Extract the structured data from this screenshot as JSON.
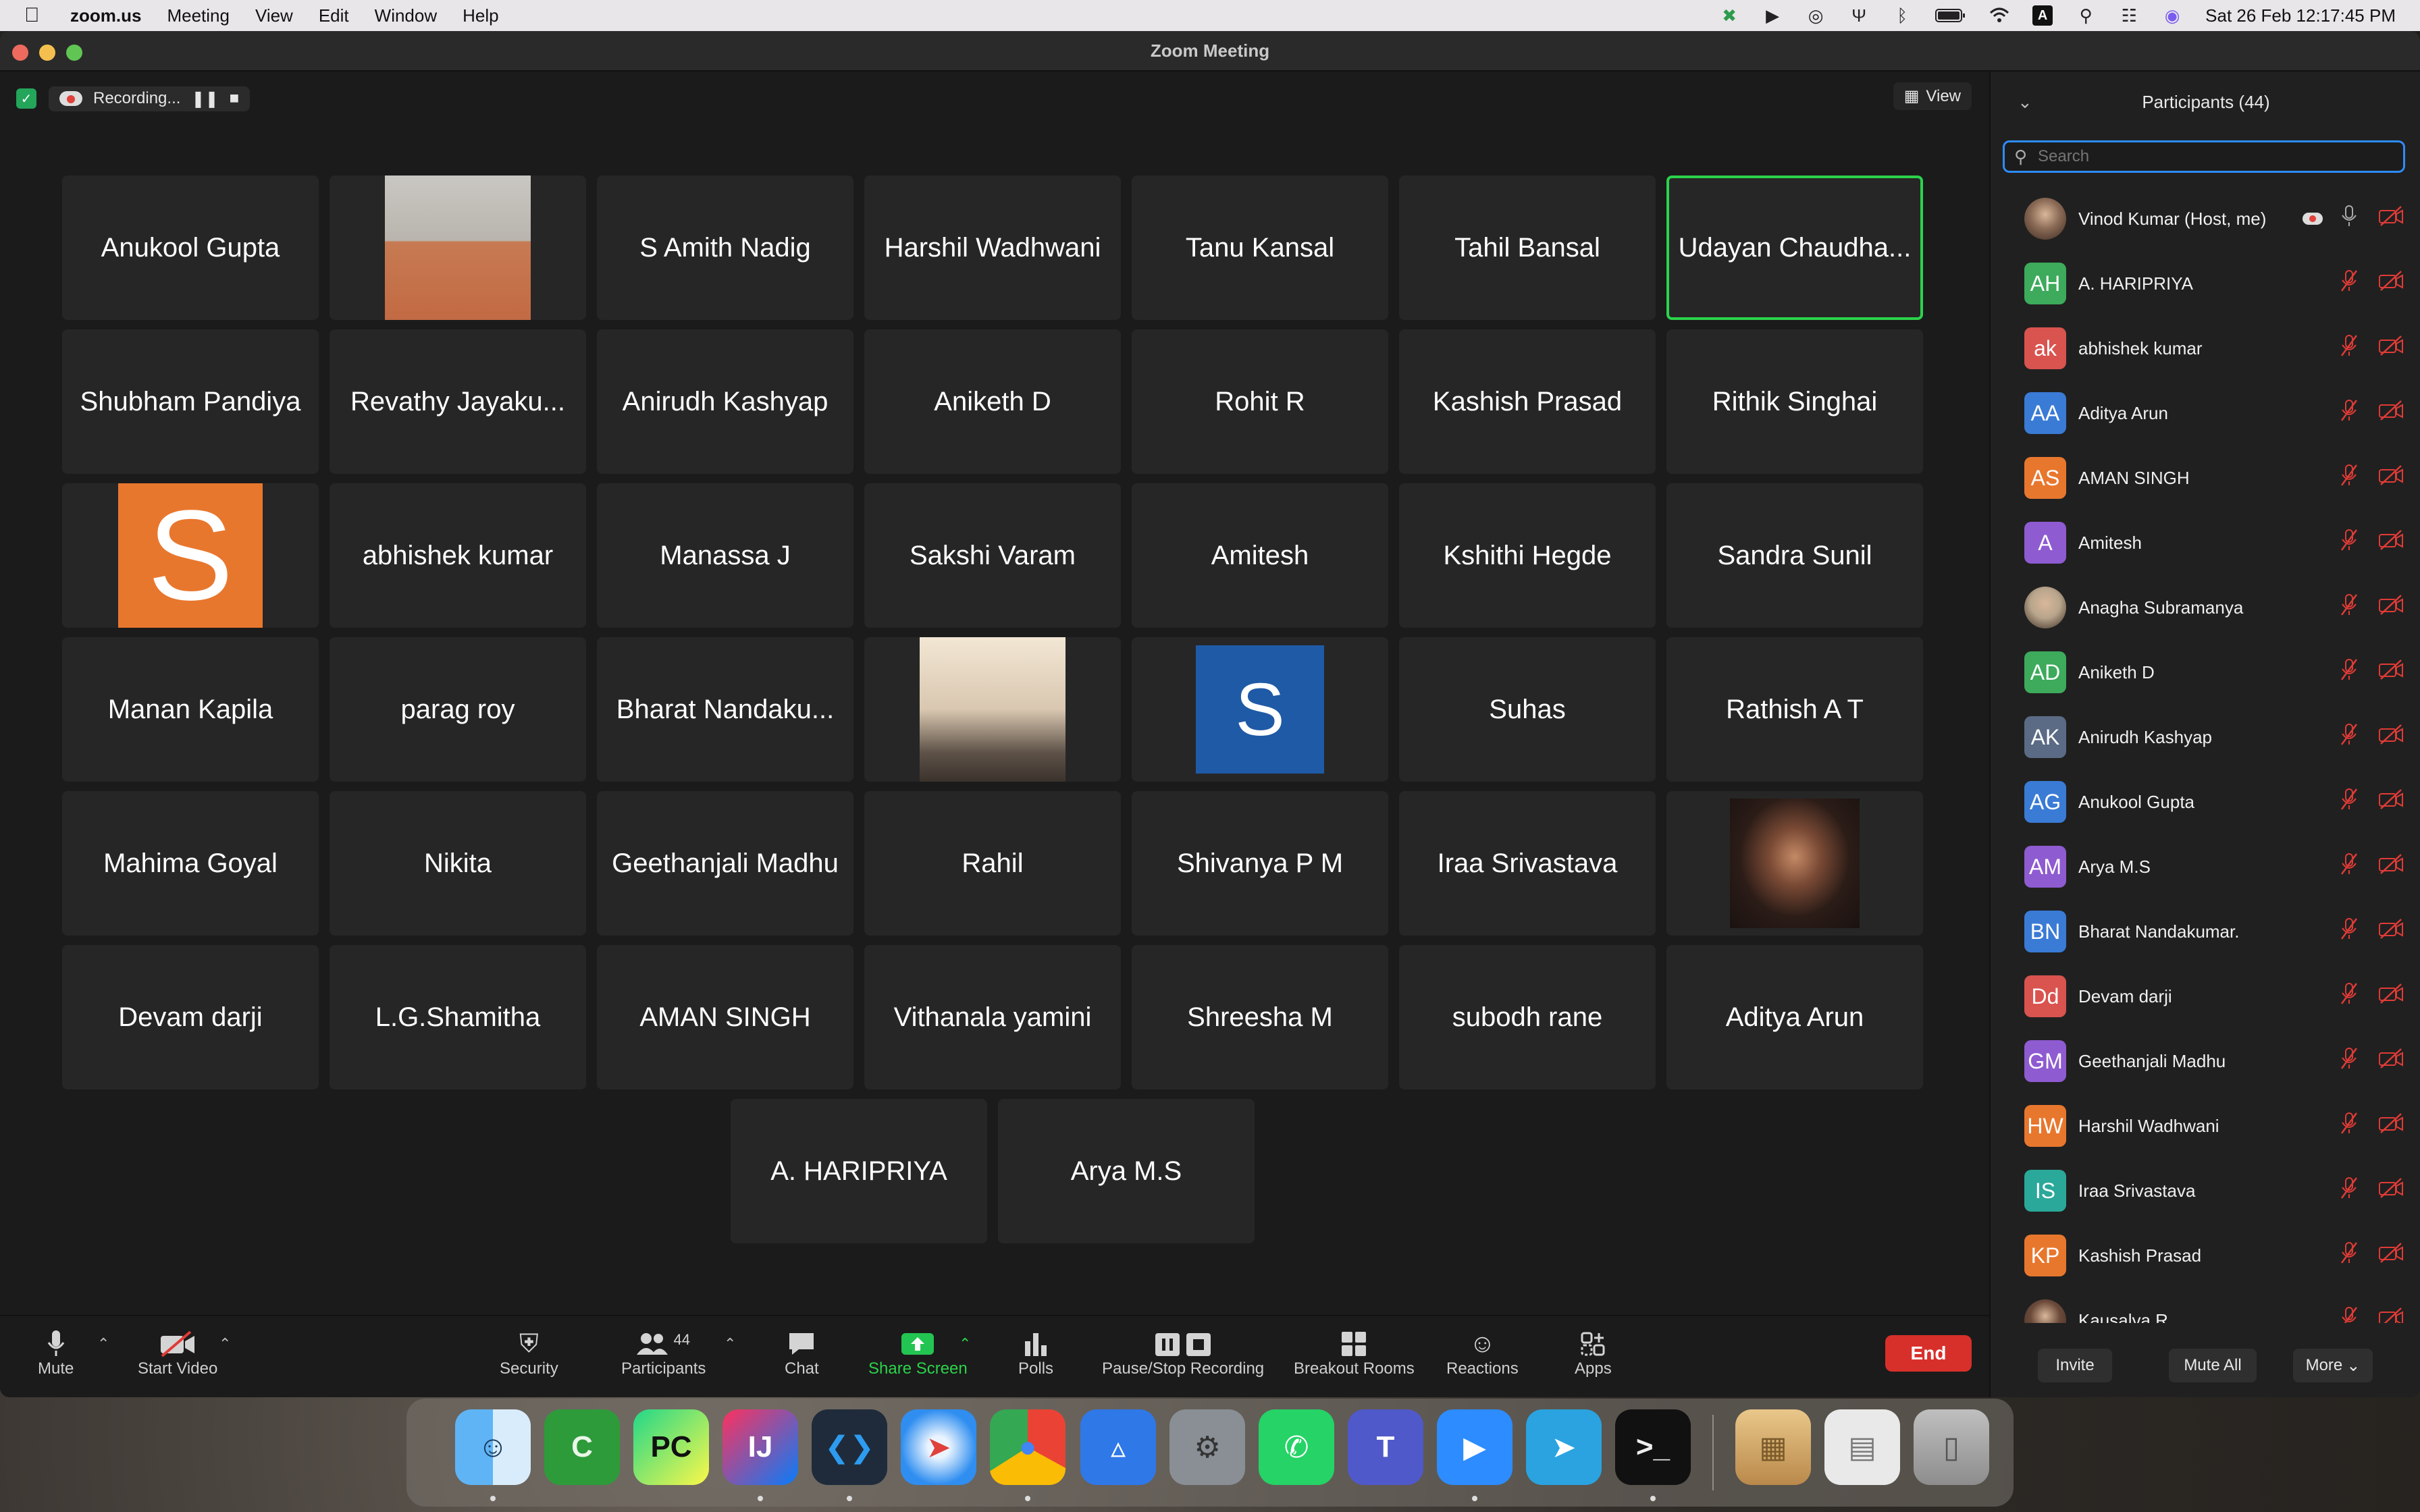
{
  "menubar": {
    "app": "zoom.us",
    "items": [
      "Meeting",
      "View",
      "Edit",
      "Window",
      "Help"
    ],
    "clock": "Sat 26 Feb  12:17:45 PM"
  },
  "window": {
    "title": "Zoom Meeting"
  },
  "meeting": {
    "recording_label": "Recording...",
    "view_label": "View",
    "tiles": [
      {
        "name": "Anukool Gupta"
      },
      {
        "name": "",
        "photo": "man-photo"
      },
      {
        "name": "S Amith Nadig"
      },
      {
        "name": "Harshil Wadhwani"
      },
      {
        "name": "Tanu Kansal"
      },
      {
        "name": "Tahil Bansal"
      },
      {
        "name": "Udayan Chaudha...",
        "active": true
      },
      {
        "name": "Shubham Pandiya"
      },
      {
        "name": "Revathy Jayaku..."
      },
      {
        "name": "Anirudh Kashyap"
      },
      {
        "name": "Aniketh D"
      },
      {
        "name": "Rohit R"
      },
      {
        "name": "Kashish Prasad"
      },
      {
        "name": "Rithik Singhai"
      },
      {
        "name": "",
        "letter": "S",
        "letter_color": "#e8772e"
      },
      {
        "name": "abhishek kumar"
      },
      {
        "name": "Manassa J"
      },
      {
        "name": "Sakshi Varam"
      },
      {
        "name": "Amitesh"
      },
      {
        "name": "Kshithi Hegde"
      },
      {
        "name": "Sandra Sunil"
      },
      {
        "name": "Manan Kapila"
      },
      {
        "name": "parag roy"
      },
      {
        "name": "Bharat Nandaku..."
      },
      {
        "name": "",
        "photo": "sunset-photo"
      },
      {
        "name": "",
        "letter": "S",
        "letter_color": "#1f5aa6"
      },
      {
        "name": "Suhas"
      },
      {
        "name": "Rathish A T"
      },
      {
        "name": "Mahima Goyal"
      },
      {
        "name": "Nikita"
      },
      {
        "name": "Geethanjali Madhu"
      },
      {
        "name": "Rahil"
      },
      {
        "name": "Shivanya P M"
      },
      {
        "name": "Iraa Srivastava"
      },
      {
        "name": "",
        "photo": "woman-photo"
      },
      {
        "name": "Devam darji"
      },
      {
        "name": "L.G.Shamitha"
      },
      {
        "name": "AMAN SINGH"
      },
      {
        "name": "Vithanala yamini"
      },
      {
        "name": "Shreesha M"
      },
      {
        "name": "subodh rane"
      },
      {
        "name": "Aditya Arun"
      },
      {
        "name": "A. HARIPRIYA"
      },
      {
        "name": "Arya M.S"
      }
    ]
  },
  "toolbar": {
    "mute": "Mute",
    "start_video": "Start Video",
    "security": "Security",
    "participants": "Participants",
    "participants_count": "44",
    "chat": "Chat",
    "share_screen": "Share Screen",
    "polls": "Polls",
    "pause_stop_recording": "Pause/Stop Recording",
    "breakout_rooms": "Breakout Rooms",
    "reactions": "Reactions",
    "apps": "Apps",
    "end": "End"
  },
  "panel": {
    "title": "Participants (44)",
    "search_placeholder": "Search",
    "participants": [
      {
        "name": "Vinod Kumar (Host, me)",
        "initials": "",
        "color": "#8a6a55",
        "photo": true,
        "host": true
      },
      {
        "name": "A. HARIPRIYA",
        "initials": "AH",
        "color": "#3daa5c"
      },
      {
        "name": "abhishek kumar",
        "initials": "ak",
        "color": "#d9534f"
      },
      {
        "name": "Aditya Arun",
        "initials": "AA",
        "color": "#3a7bd5"
      },
      {
        "name": "AMAN SINGH",
        "initials": "AS",
        "color": "#e8772e"
      },
      {
        "name": "Amitesh",
        "initials": "A",
        "color": "#8e5bd1"
      },
      {
        "name": "Anagha Subramanya",
        "initials": "",
        "color": "#b8a58c",
        "photo": true
      },
      {
        "name": "Aniketh D",
        "initials": "AD",
        "color": "#3daa5c"
      },
      {
        "name": "Anirudh Kashyap",
        "initials": "AK",
        "color": "#5b6b85"
      },
      {
        "name": "Anukool Gupta",
        "initials": "AG",
        "color": "#3a7bd5"
      },
      {
        "name": "Arya M.S",
        "initials": "AM",
        "color": "#8e5bd1"
      },
      {
        "name": "Bharat Nandakumar.",
        "initials": "BN",
        "color": "#3a7bd5"
      },
      {
        "name": "Devam darji",
        "initials": "Dd",
        "color": "#d9534f"
      },
      {
        "name": "Geethanjali Madhu",
        "initials": "GM",
        "color": "#8e5bd1"
      },
      {
        "name": "Harshil Wadhwani",
        "initials": "HW",
        "color": "#e8772e"
      },
      {
        "name": "Iraa Srivastava",
        "initials": "IS",
        "color": "#2aa89a"
      },
      {
        "name": "Kashish Prasad",
        "initials": "KP",
        "color": "#e8772e"
      },
      {
        "name": "Kausalya R",
        "initials": "",
        "color": "#6b4a3a",
        "photo": true
      }
    ],
    "invite": "Invite",
    "mute_all": "Mute All",
    "more": "More"
  },
  "dock": {
    "apps": [
      "Finder",
      "Camtasia",
      "PyCharm",
      "IntelliJ IDEA",
      "VS Code",
      "Safari",
      "Chrome",
      "Keynote",
      "System Preferences",
      "WhatsApp",
      "Teams",
      "Zoom",
      "Telegram",
      "Terminal",
      "Archive Utility",
      "Preview",
      "Trash"
    ]
  }
}
